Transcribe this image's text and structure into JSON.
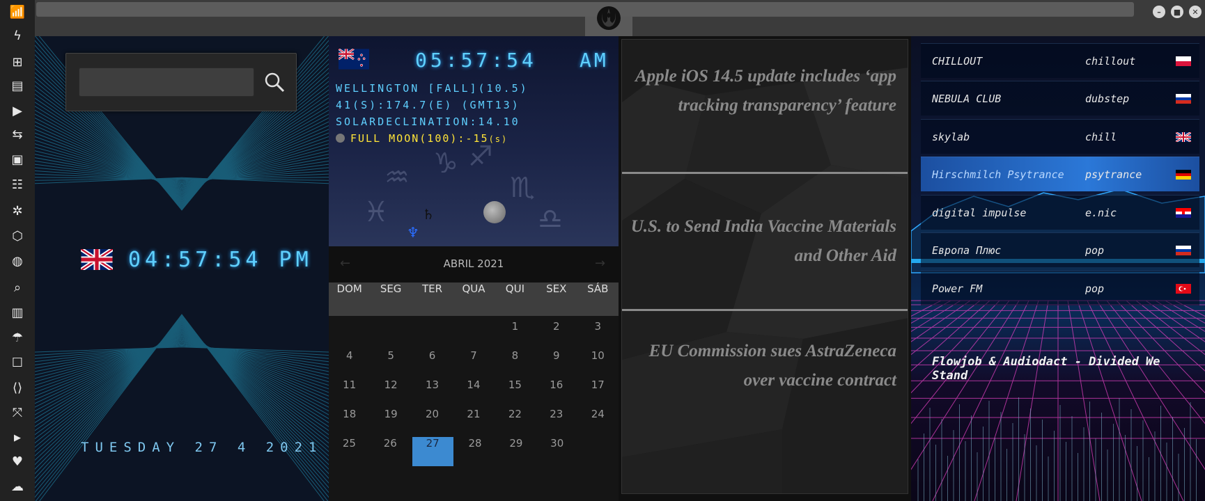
{
  "app": {
    "sidebar_icons": [
      "wifi-icon",
      "lightning-icon",
      "windows-icon",
      "archive-icon",
      "play-icon",
      "translate-icon",
      "image-icon",
      "news-icon",
      "settings-badge-icon",
      "hexagon-icon",
      "globe-icon",
      "search-icon",
      "map-icon",
      "umbrella-icon",
      "contacts-icon",
      "code-icon",
      "fullscreen-icon",
      "youtube-icon",
      "heart-icon",
      "cloud-icon"
    ],
    "window_buttons": [
      "–",
      "■",
      "✕"
    ]
  },
  "clock_london": {
    "time": "04:57:54 PM",
    "date": "TUESDAY 27 4 2021",
    "search_placeholder": ""
  },
  "clock_wellington": {
    "time": "05:57:54",
    "ampm": "AM",
    "line1": "WELLINGTON [FALL](10.5)",
    "line2": "41(S):174.7(E) (GMT13)",
    "line3": "SOLARDECLINATION:14.10",
    "moon": "FULL MOON(100):-15",
    "moon_suffix": "(s)"
  },
  "calendar": {
    "title": "ABRIL 2021",
    "prev": "←",
    "next": "→",
    "weekdays": [
      "DOM",
      "SEG",
      "TER",
      "QUA",
      "QUI",
      "SEX",
      "SÁB"
    ],
    "weeks": [
      [
        "",
        "",
        "",
        "",
        "1",
        "2",
        "3"
      ],
      [
        "4",
        "5",
        "6",
        "7",
        "8",
        "9",
        "10"
      ],
      [
        "11",
        "12",
        "13",
        "14",
        "15",
        "16",
        "17"
      ],
      [
        "18",
        "19",
        "20",
        "21",
        "22",
        "23",
        "24"
      ],
      [
        "25",
        "26",
        "27",
        "28",
        "29",
        "30",
        ""
      ]
    ],
    "today": "27"
  },
  "news": {
    "items": [
      "Apple iOS 14.5 update includes ‘app tracking transparency’ feature",
      "U.S. to Send India Vaccine Materials and Other Aid",
      "EU Commission sues AstraZeneca over vaccine contract"
    ]
  },
  "radio": {
    "stations": [
      {
        "name": "CHILLOUT",
        "genre": "chillout",
        "flag": "pl"
      },
      {
        "name": "NEBULA CLUB",
        "genre": "dubstep",
        "flag": "ru"
      },
      {
        "name": "skylab",
        "genre": "chill",
        "flag": "uk"
      },
      {
        "name": "Hirschmilch Psytrance",
        "genre": "psytrance",
        "flag": "de"
      },
      {
        "name": "digital impulse",
        "genre": "e.nic",
        "flag": "hr"
      },
      {
        "name": "Европа Плюс",
        "genre": "pop",
        "flag": "ru"
      },
      {
        "name": "Power FM",
        "genre": "pop",
        "flag": "tr"
      }
    ],
    "active_index": 3,
    "now_playing": "Flowjob & Audiodact - Divided We Stand"
  }
}
